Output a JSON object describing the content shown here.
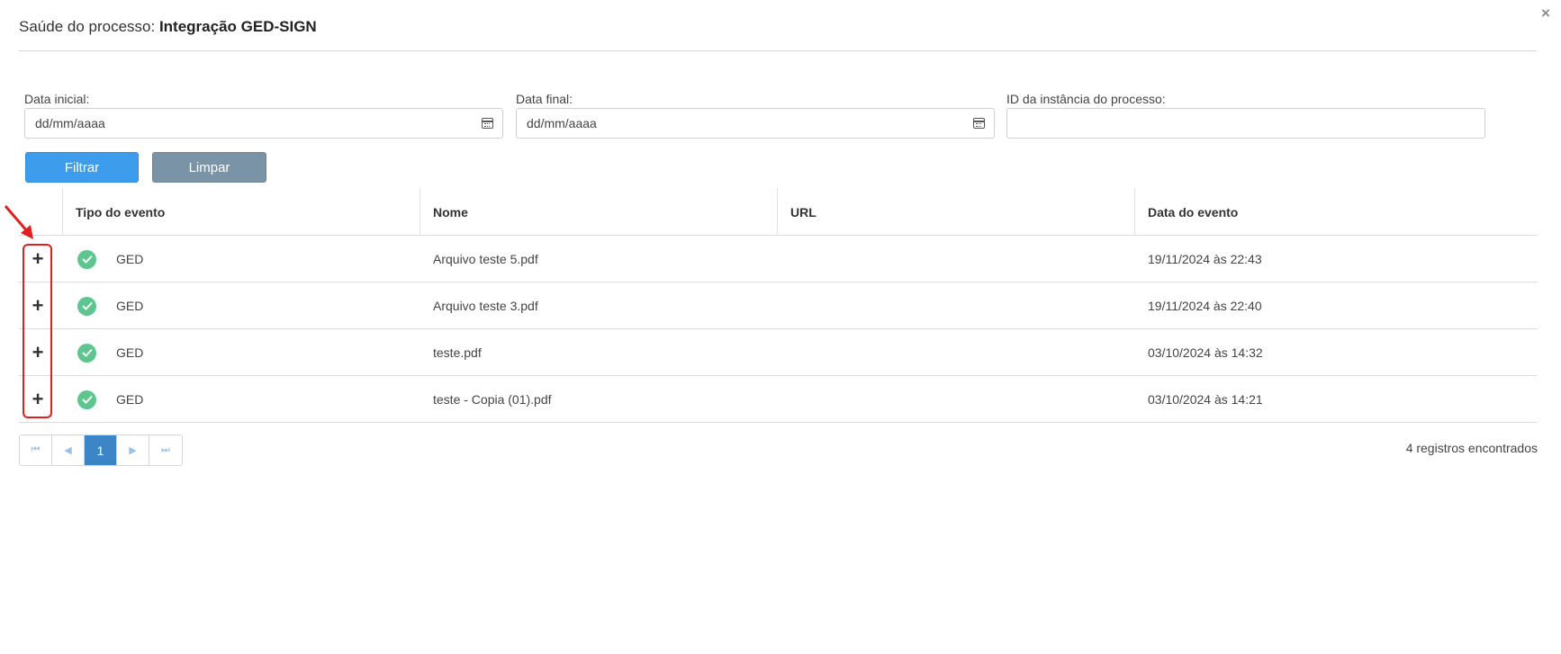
{
  "dialog": {
    "title_prefix": "Saúde do processo:",
    "title_name": "Integração GED-SIGN",
    "close_glyph": "×"
  },
  "filters": {
    "start_date": {
      "label": "Data inicial:",
      "value": "dd/mm/aaaa"
    },
    "end_date": {
      "label": "Data final:",
      "value": "dd/mm/aaaa"
    },
    "instance_id": {
      "label": "ID da instância do processo:",
      "value": ""
    },
    "filter_button": "Filtrar",
    "clear_button": "Limpar"
  },
  "table": {
    "headers": [
      "Tipo do evento",
      "Nome",
      "URL",
      "Data do evento"
    ],
    "rows": [
      {
        "expand": "+",
        "status": "check-circle-icon",
        "event_type": "GED",
        "name": "Arquivo teste 5.pdf",
        "url": "",
        "date": "19/11/2024 às 22:43"
      },
      {
        "expand": "+",
        "status": "check-circle-icon",
        "event_type": "GED",
        "name": "Arquivo teste 3.pdf",
        "url": "",
        "date": "19/11/2024 às 22:40"
      },
      {
        "expand": "+",
        "status": "check-circle-icon",
        "event_type": "GED",
        "name": "teste.pdf",
        "url": "",
        "date": "03/10/2024 às 14:32"
      },
      {
        "expand": "+",
        "status": "check-circle-icon",
        "event_type": "GED",
        "name": "teste - Copia (01).pdf",
        "url": "",
        "date": "03/10/2024 às 14:21"
      }
    ]
  },
  "pagination": {
    "first": "⏮",
    "prev": "◀",
    "current_page": "1",
    "next": "▶",
    "last": "⏭",
    "records_text": "4 registros encontrados"
  },
  "colors": {
    "primary_button": "#3d9ceb",
    "secondary_button": "#7a93a6",
    "success_icon": "#5fc58f",
    "active_page": "#3c86c8",
    "annotation": "#e02020"
  }
}
